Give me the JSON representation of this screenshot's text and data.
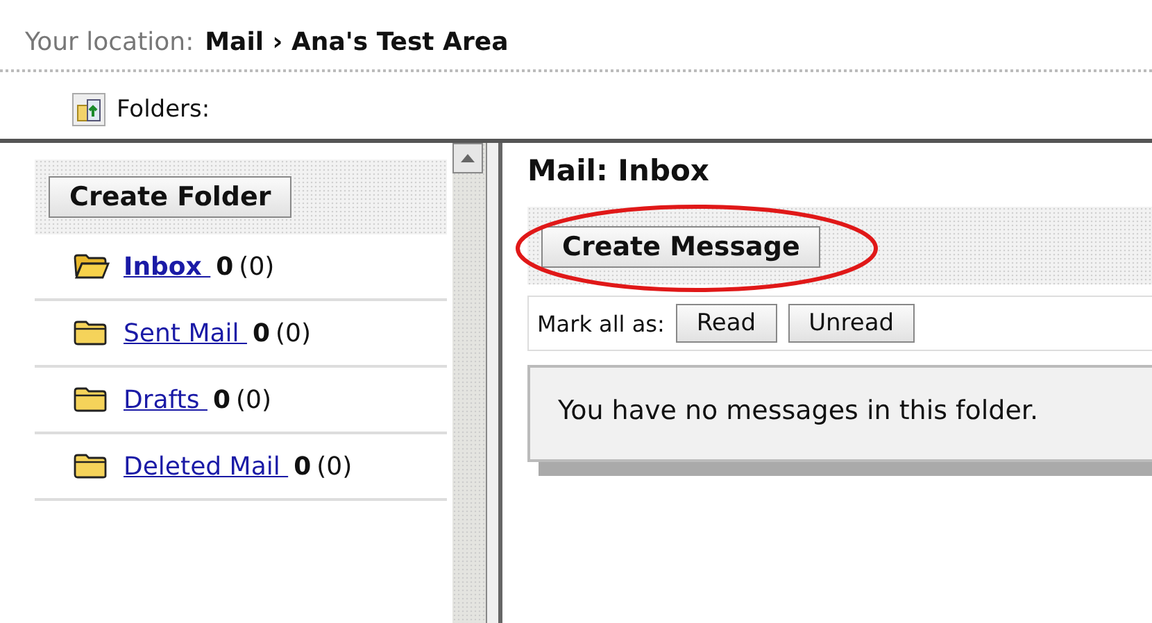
{
  "location": {
    "label": "Your location:",
    "path": "Mail › Ana's Test Area"
  },
  "folders_header": {
    "label": "Folders:"
  },
  "sidebar": {
    "button": "Create Folder",
    "items": [
      {
        "name": "Inbox ",
        "count": "0",
        "unread": "(0)",
        "selected": true
      },
      {
        "name": "Sent Mail ",
        "count": "0",
        "unread": "(0)",
        "selected": false
      },
      {
        "name": "Drafts ",
        "count": "0",
        "unread": "(0)",
        "selected": false
      },
      {
        "name": "Deleted Mail ",
        "count": "0",
        "unread": "(0)",
        "selected": false
      }
    ]
  },
  "main": {
    "title": "Mail: Inbox",
    "create_button": {
      "label": "Create Message",
      "highlighted": true
    },
    "mark_all": {
      "label": "Mark all as:",
      "buttons": [
        "Read",
        "Unread"
      ]
    },
    "empty_message": "You have no messages in this folder."
  }
}
